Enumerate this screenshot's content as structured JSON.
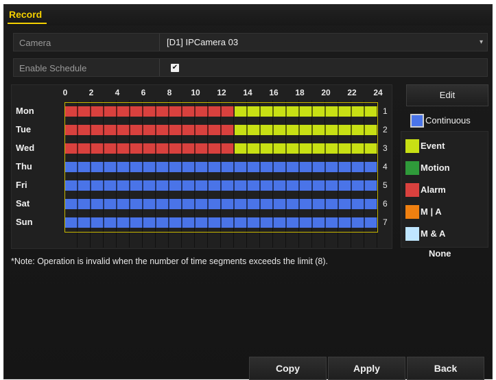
{
  "window": {
    "title": "Record"
  },
  "camera": {
    "label": "Camera",
    "value": "[D1] IPCamera 03"
  },
  "enable_schedule": {
    "label": "Enable Schedule",
    "checked": true
  },
  "schedule": {
    "hour_labels": [
      "0",
      "2",
      "4",
      "6",
      "8",
      "10",
      "12",
      "14",
      "16",
      "18",
      "20",
      "22",
      "24"
    ],
    "days": [
      {
        "label": "Mon",
        "index": "1",
        "segments": [
          {
            "type": "Alarm",
            "start": 0,
            "end": 13
          },
          {
            "type": "Event",
            "start": 13,
            "end": 24
          }
        ]
      },
      {
        "label": "Tue",
        "index": "2",
        "segments": [
          {
            "type": "Alarm",
            "start": 0,
            "end": 13
          },
          {
            "type": "Event",
            "start": 13,
            "end": 24
          }
        ]
      },
      {
        "label": "Wed",
        "index": "3",
        "segments": [
          {
            "type": "Alarm",
            "start": 0,
            "end": 13
          },
          {
            "type": "Event",
            "start": 13,
            "end": 24
          }
        ]
      },
      {
        "label": "Thu",
        "index": "4",
        "segments": [
          {
            "type": "Continuous",
            "start": 0,
            "end": 24
          }
        ]
      },
      {
        "label": "Fri",
        "index": "5",
        "segments": [
          {
            "type": "Continuous",
            "start": 0,
            "end": 24
          }
        ]
      },
      {
        "label": "Sat",
        "index": "6",
        "segments": [
          {
            "type": "Continuous",
            "start": 0,
            "end": 24
          }
        ]
      },
      {
        "label": "Sun",
        "index": "7",
        "segments": [
          {
            "type": "Continuous",
            "start": 0,
            "end": 24
          }
        ]
      }
    ]
  },
  "edit_button": {
    "label": "Edit"
  },
  "legend": [
    {
      "label": "Continuous",
      "color": "#4a74e8"
    },
    {
      "label": "Event",
      "color": "#c8e014"
    },
    {
      "label": "Motion",
      "color": "#2f9a3a"
    },
    {
      "label": "Alarm",
      "color": "#d9413e"
    },
    {
      "label": "M | A",
      "color": "#f08010"
    },
    {
      "label": "M & A",
      "color": "#bfe6ff"
    },
    {
      "label": "None",
      "color": ""
    }
  ],
  "note": "*Note: Operation is invalid when the number of time segments exceeds the limit (8).",
  "buttons": {
    "copy": "Copy",
    "apply": "Apply",
    "back": "Back"
  }
}
